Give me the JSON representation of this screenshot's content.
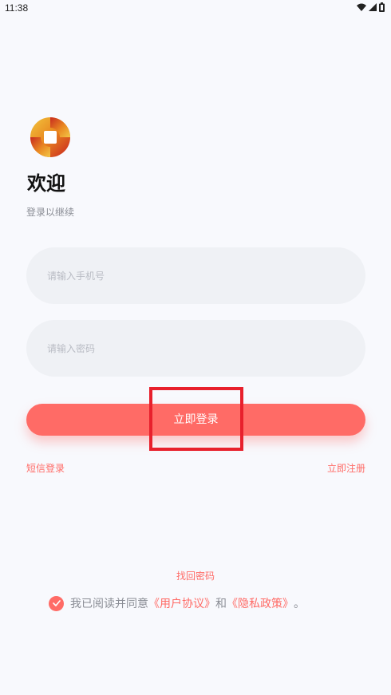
{
  "status_bar": {
    "time": "11:38",
    "icons": [
      "wifi-icon",
      "signal-icon",
      "battery-icon"
    ]
  },
  "brand": {
    "logo": "bank-logo",
    "accent_color": "#ff6b66"
  },
  "header": {
    "title": "欢迎",
    "subtitle": "登录以继续"
  },
  "form": {
    "phone_placeholder": "请输入手机号",
    "password_placeholder": "请输入密码",
    "login_label": "立即登录"
  },
  "links": {
    "sms_login": "短信登录",
    "register": "立即注册",
    "forgot_password": "找回密码"
  },
  "agreement": {
    "checked": true,
    "prefix": "我已阅读并同意",
    "user_agreement": "《用户协议》",
    "and": "和",
    "privacy_policy": "《隐私政策》",
    "suffix": "。"
  }
}
